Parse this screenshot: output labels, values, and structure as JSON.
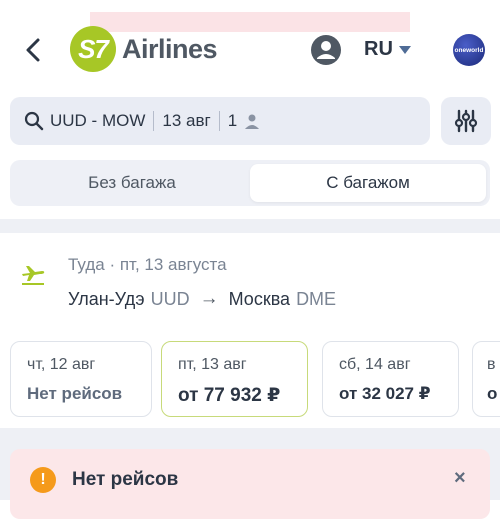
{
  "header": {
    "logo_badge": "S7",
    "logo_text": "Airlines",
    "language": "RU",
    "alliance_badge": "oneworld"
  },
  "search": {
    "route": "UUD - MOW",
    "date": "13 авг",
    "passengers": "1"
  },
  "baggage": {
    "without": "Без багажа",
    "with": "С багажом",
    "selected": "with"
  },
  "route": {
    "date_label": "Туда · пт, 13 августа",
    "from_city": "Улан-Удэ",
    "from_code": "UUD",
    "to_city": "Москва",
    "to_code": "DME"
  },
  "dates": [
    {
      "day": "чт, 12 авг",
      "price": "Нет рейсов"
    },
    {
      "day": "пт, 13 авг",
      "price": "от 77 932 ₽"
    },
    {
      "day": "сб, 14 авг",
      "price": "от 32 027 ₽"
    },
    {
      "day": "в",
      "price": "о"
    }
  ],
  "alert": {
    "title": "Нет рейсов",
    "close": "×"
  },
  "colors": {
    "brand_green": "#a7c726",
    "warning_orange": "#f59a1b",
    "alert_bg": "#fce7e9",
    "text_dark": "#2c3645"
  }
}
